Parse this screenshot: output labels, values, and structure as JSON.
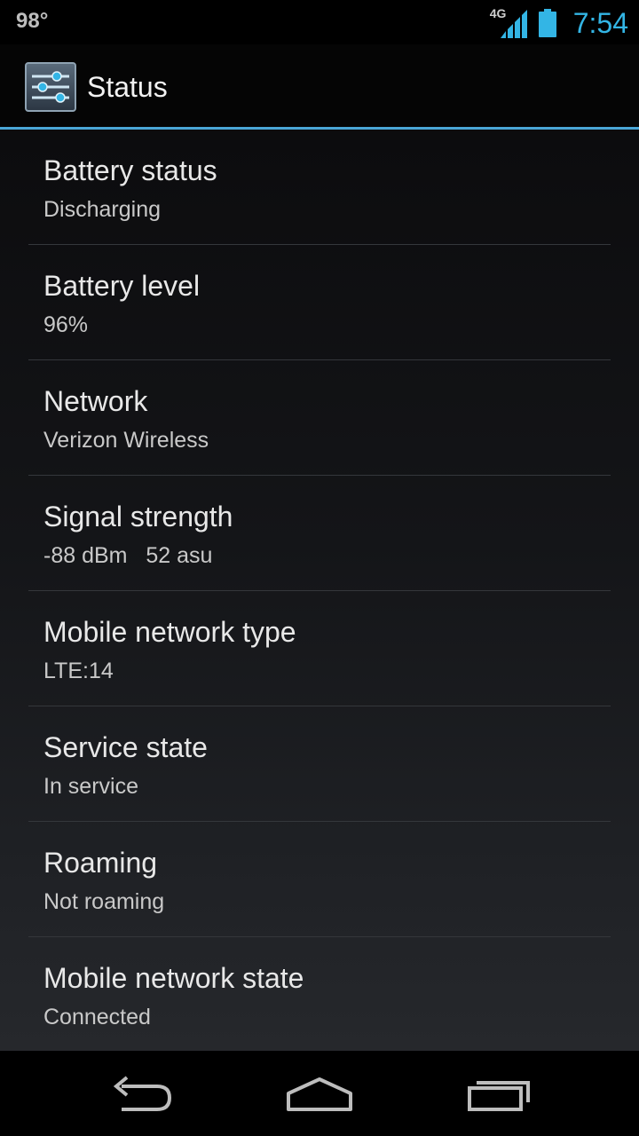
{
  "status_bar": {
    "temperature": "98°",
    "network_type": "4G",
    "time": "7:54",
    "icons": [
      "signal-icon",
      "battery-icon"
    ]
  },
  "action_bar": {
    "title": "Status",
    "icon": "settings-sliders-icon"
  },
  "items": [
    {
      "title": "Battery status",
      "value": "Discharging"
    },
    {
      "title": "Battery level",
      "value": "96%"
    },
    {
      "title": "Network",
      "value": "Verizon Wireless"
    },
    {
      "title": "Signal strength",
      "value": "-88 dBm   52 asu"
    },
    {
      "title": "Mobile network type",
      "value": "LTE:14"
    },
    {
      "title": "Service state",
      "value": "In service"
    },
    {
      "title": "Roaming",
      "value": "Not roaming"
    },
    {
      "title": "Mobile network state",
      "value": "Connected"
    }
  ],
  "nav_bar": {
    "icons": [
      "back-icon",
      "home-icon",
      "recent-apps-icon"
    ]
  },
  "colors": {
    "accent": "#33b5e5",
    "divider": "#4aa6d6"
  }
}
